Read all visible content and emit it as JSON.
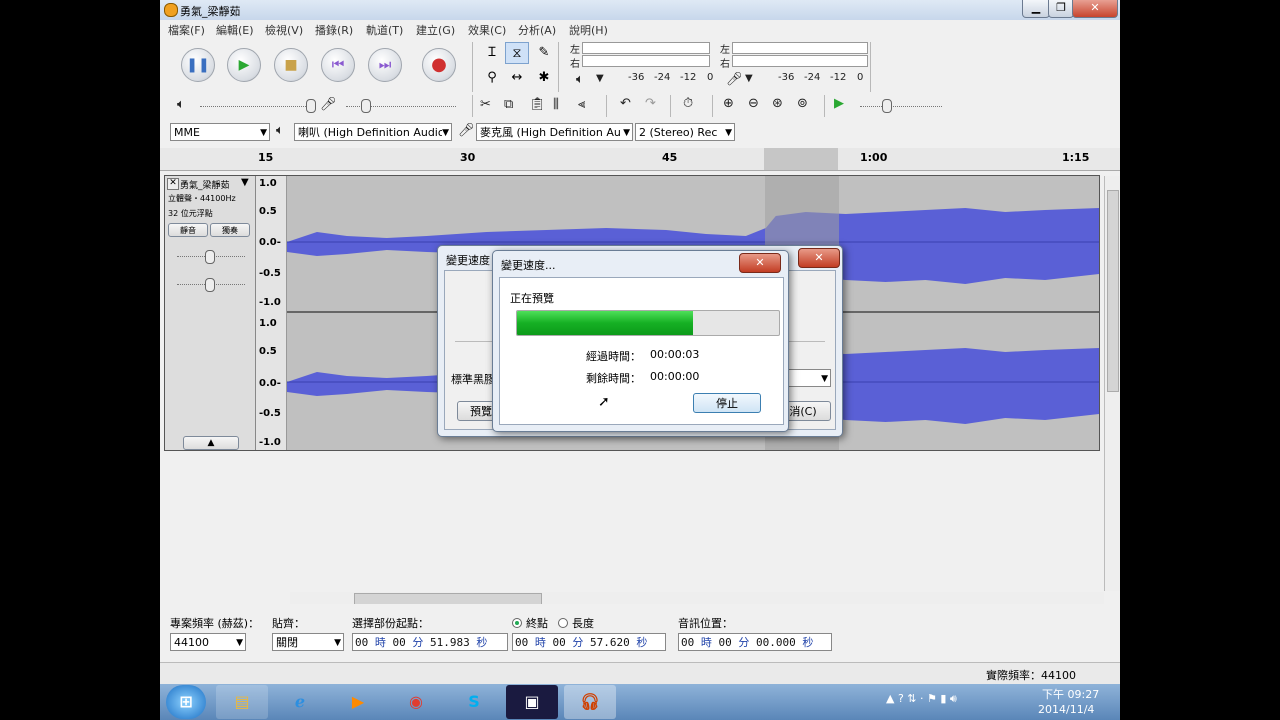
{
  "window": {
    "title": "勇氣_梁靜茹"
  },
  "menu": [
    "檔案(F)",
    "編輯(E)",
    "檢視(V)",
    "播錄(R)",
    "軌道(T)",
    "建立(G)",
    "效果(C)",
    "分析(A)",
    "說明(H)"
  ],
  "meters": {
    "left": "左",
    "right": "右",
    "play_ticks": [
      "-36",
      "-24",
      "-12",
      "0"
    ],
    "rec_ticks": [
      "-36",
      "-24",
      "-12",
      "0"
    ]
  },
  "devices": {
    "host": "MME",
    "output": "喇叭 (High Definition Audio",
    "input": "麥克風 (High Definition Au",
    "channels": "2 (Stereo) Rec"
  },
  "ruler": [
    "15",
    "30",
    "45",
    "1:00",
    "1:15"
  ],
  "track": {
    "name": "勇氣_梁靜茹",
    "info1": "立體聲・44100Hz",
    "info2": "32 位元浮點",
    "mute": "靜音",
    "solo": "獨奏",
    "scale": [
      "1.0",
      "0.5",
      "0.0-",
      "-0.5",
      "-1.0"
    ]
  },
  "back_dialog": {
    "title": "變更速度",
    "label": "標準黑膠",
    "preview": "預覽",
    "cancel": "消(C)"
  },
  "progress_dialog": {
    "title": "變更速度...",
    "status": "正在預覽",
    "progress": 0.67,
    "elapsed_label": "經過時間：",
    "elapsed": "00:00:03",
    "remaining_label": "剩餘時間：",
    "remaining": "00:00:00",
    "stop": "停止"
  },
  "statusbar": {
    "rate_label": "專案頻率 (赫茲)：",
    "rate": "44100",
    "snap_label": "貼齊：",
    "snap": "關閉",
    "sel_start_label": "選擇部份起點：",
    "end_label": "終點",
    "length_label": "長度",
    "audio_pos_label": "音訊位置：",
    "sel_start": {
      "h": "00",
      "m": "00",
      "s": "51.983"
    },
    "sel_end": {
      "h": "00",
      "m": "00",
      "s": "57.620"
    },
    "audio_pos": {
      "h": "00",
      "m": "00",
      "s": "00.000"
    },
    "unit_h": "時",
    "unit_m": "分",
    "unit_s": "秒",
    "actual_rate": "實際頻率：44100"
  },
  "taskbar": {
    "time": "下午 09:27",
    "date": "2014/11/4"
  }
}
